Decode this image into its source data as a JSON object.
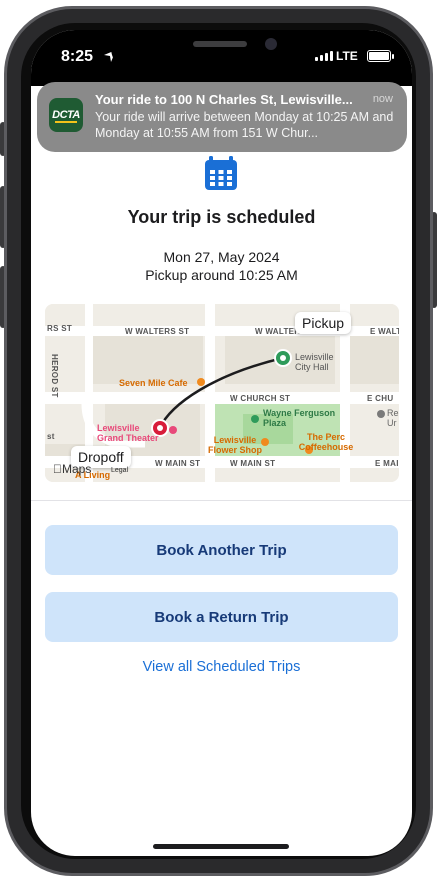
{
  "status_bar": {
    "time": "8:25",
    "network": "LTE"
  },
  "notification": {
    "app_logo_text": "DCTA",
    "title": "Your ride to 100 N Charles St, Lewisville...",
    "time": "now",
    "body": "Your ride will arrive between Monday at 10:25 AM and Monday at 10:55 AM from 151 W Chur..."
  },
  "trip": {
    "title": "Your trip is scheduled",
    "date": "Mon 27, May 2024",
    "pickup": "Pickup around 10:25 AM"
  },
  "map": {
    "pickup_callout": "Pickup",
    "dropoff_callout": "Dropoff",
    "maps_brand": "Maps",
    "legal": "Legal",
    "streets": {
      "walters_left": "RS ST",
      "walters_mid": "W WALTERS ST",
      "walters_right": "W WALTERS ST",
      "walters_far": "E WALT",
      "church": "W CHURCH ST",
      "church_right": "E CHU",
      "main": "W MAIN ST",
      "main_right": "W MAIN ST",
      "main_far": "E MAI",
      "herod": "HEROD ST",
      "st_left": "st"
    },
    "pois": {
      "city_hall": "Lewisville City Hall",
      "seven_mile": "Seven Mile Cafe",
      "wayne": "Wayne Ferguson Plaza",
      "lewisville_flower": "Lewisville Flower Shop",
      "perc": "The Perc Coffeehouse",
      "grand_theater": "Lewisville Grand Theater",
      "living": "A Living",
      "re": "Re Ur"
    }
  },
  "actions": {
    "book_another": "Book Another Trip",
    "book_return": "Book a Return Trip",
    "view_all": "View all Scheduled Trips"
  }
}
